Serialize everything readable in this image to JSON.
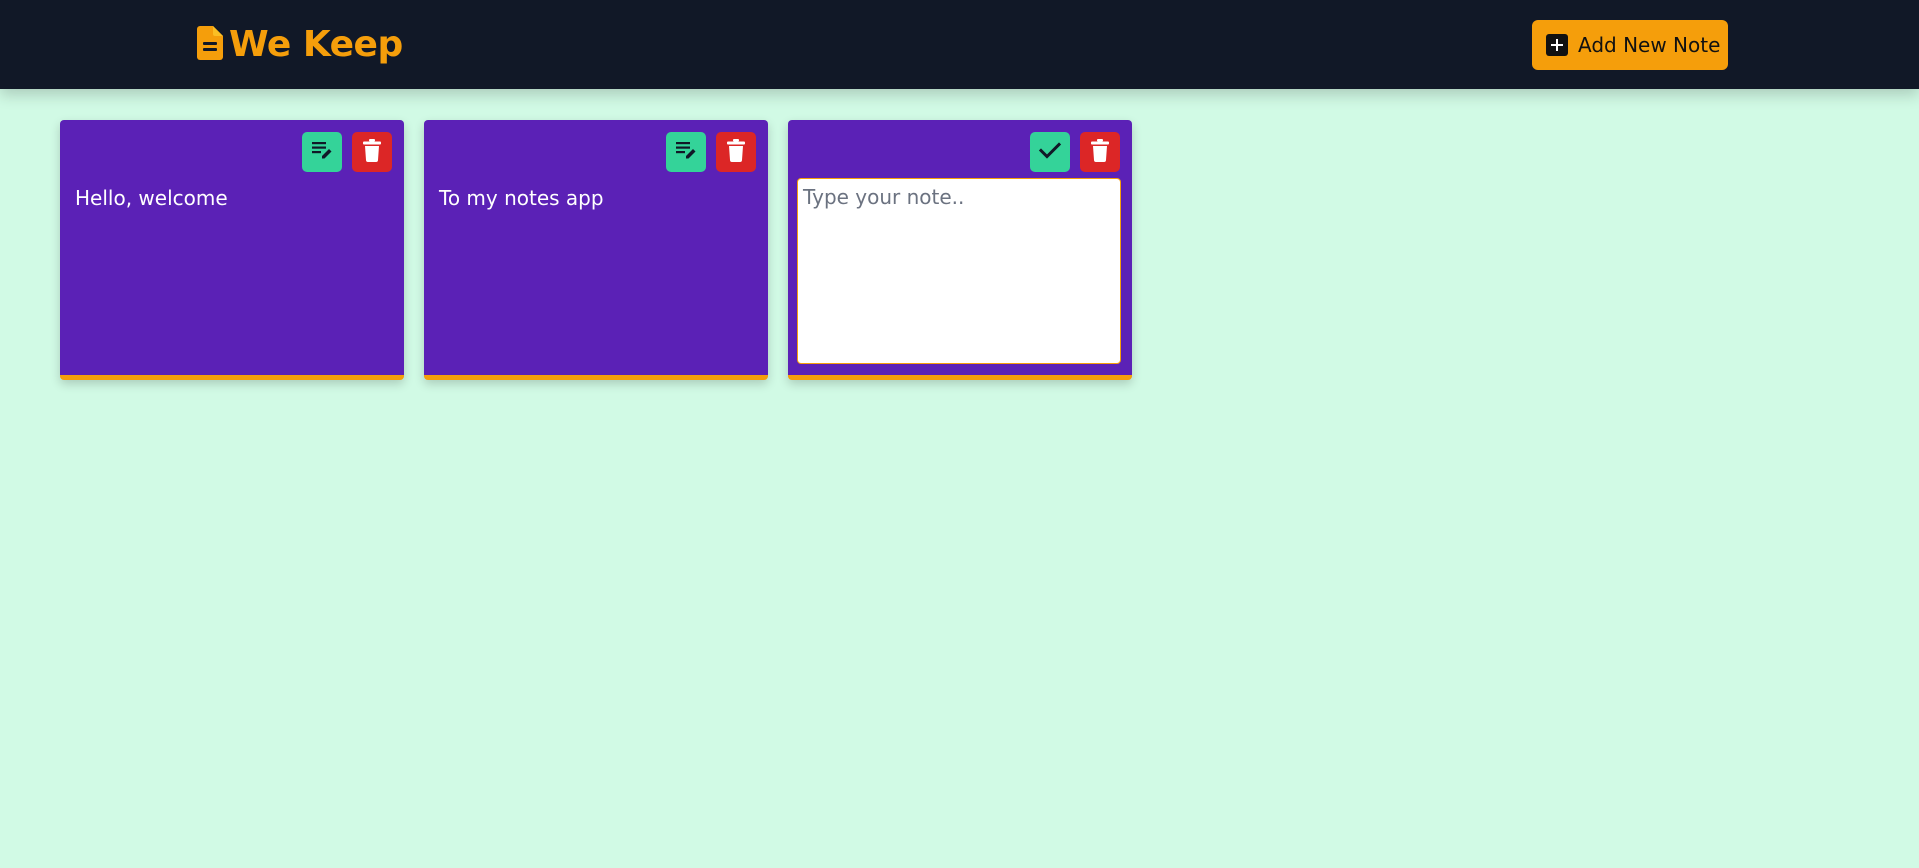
{
  "header": {
    "title": "We Keep",
    "logo_icon": "file-document-icon",
    "add_button_label": "Add New Note",
    "add_button_icon": "plus-square-icon"
  },
  "colors": {
    "page_background": "#d1fae5",
    "header_background": "#111827",
    "accent": "#f59e0b",
    "note_background": "#5b21b6",
    "edit_button": "#34d399",
    "delete_button": "#dc2626"
  },
  "notes": [
    {
      "text": "Hello, welcome",
      "mode": "view",
      "primary_action_icon": "edit-notes-icon",
      "delete_icon": "trash-icon"
    },
    {
      "text": "To my notes app",
      "mode": "view",
      "primary_action_icon": "edit-notes-icon",
      "delete_icon": "trash-icon"
    },
    {
      "text": "",
      "placeholder": "Type your note..",
      "mode": "edit",
      "primary_action_icon": "check-icon",
      "delete_icon": "trash-icon"
    }
  ]
}
